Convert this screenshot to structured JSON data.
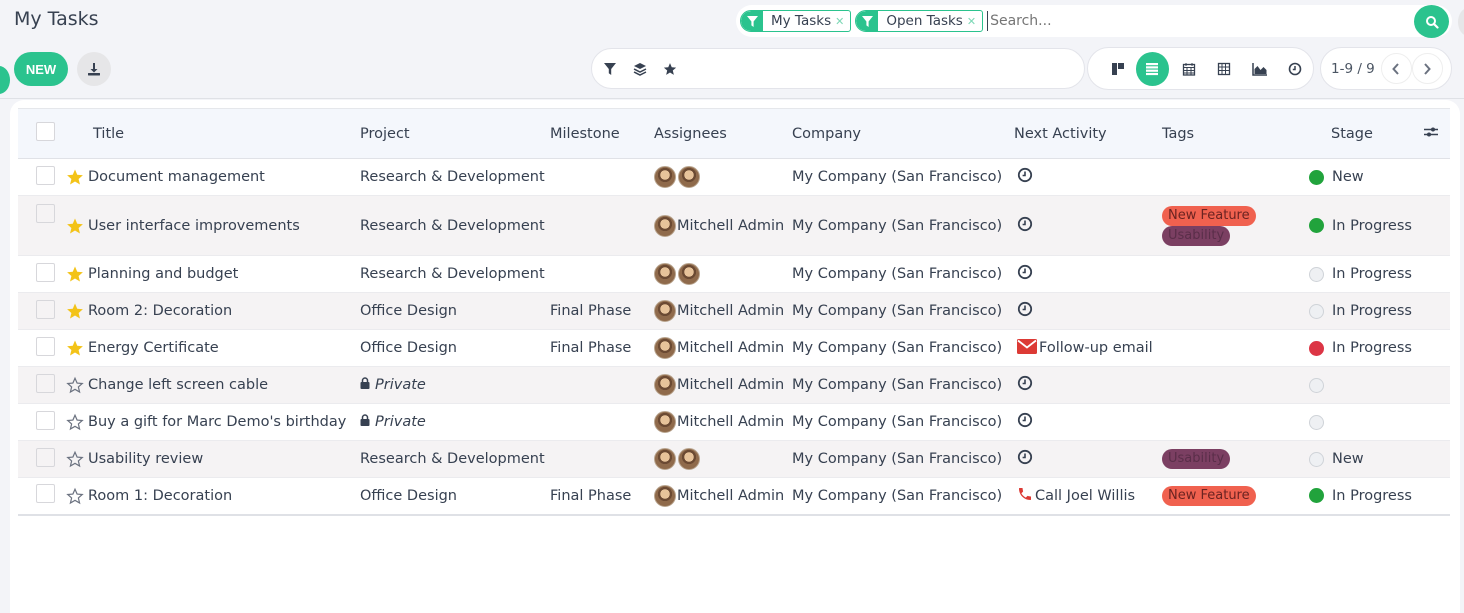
{
  "header": {
    "title": "My Tasks",
    "new_label": "NEW"
  },
  "search": {
    "facets": [
      {
        "label": "My Tasks",
        "icon": "filter-icon"
      },
      {
        "label": "Open Tasks",
        "icon": "filter-icon"
      }
    ],
    "placeholder": "Search...",
    "value": ""
  },
  "pager": {
    "value": "1-9 / 9"
  },
  "views": [
    "kanban",
    "list",
    "calendar",
    "pivot",
    "graph",
    "activity"
  ],
  "active_view": "list",
  "colors": {
    "accent": "#2bc38e",
    "tag_new_feature": "#f0614f",
    "tag_usability": "#7b3f62",
    "stage_green": "#21a33c",
    "stage_red": "#dc3545"
  },
  "table": {
    "columns": [
      "Title",
      "Project",
      "Milestone",
      "Assignees",
      "Company",
      "Next Activity",
      "Tags",
      "Stage"
    ],
    "rows": [
      {
        "starred": true,
        "title": "Document management",
        "project": "Research & Development",
        "private": false,
        "milestone": "",
        "assignees": 2,
        "assignee_name": "",
        "company": "My Company (San Francisco)",
        "activity_icon": "clock",
        "activity": "",
        "tags": [],
        "status": "green",
        "stage": "New"
      },
      {
        "starred": true,
        "title": "User interface improvements",
        "project": "Research & Development",
        "private": false,
        "milestone": "",
        "assignees": 1,
        "assignee_name": "Mitchell Admin",
        "company": "My Company (San Francisco)",
        "activity_icon": "clock",
        "activity": "",
        "tags": [
          "New Feature",
          "Usability"
        ],
        "status": "green",
        "stage": "In Progress"
      },
      {
        "starred": true,
        "title": "Planning and budget",
        "project": "Research & Development",
        "private": false,
        "milestone": "",
        "assignees": 2,
        "assignee_name": "",
        "company": "My Company (San Francisco)",
        "activity_icon": "clock",
        "activity": "",
        "tags": [],
        "status": "grey",
        "stage": "In Progress"
      },
      {
        "starred": true,
        "title": "Room 2: Decoration",
        "project": "Office Design",
        "private": false,
        "milestone": "Final Phase",
        "assignees": 1,
        "assignee_name": "Mitchell Admin",
        "company": "My Company (San Francisco)",
        "activity_icon": "clock",
        "activity": "",
        "tags": [],
        "status": "grey",
        "stage": "In Progress"
      },
      {
        "starred": true,
        "title": "Energy Certificate",
        "project": "Office Design",
        "private": false,
        "milestone": "Final Phase",
        "assignees": 1,
        "assignee_name": "Mitchell Admin",
        "company": "My Company (San Francisco)",
        "activity_icon": "envelope",
        "activity": "Follow-up email",
        "tags": [],
        "status": "red",
        "stage": "In Progress"
      },
      {
        "starred": false,
        "title": "Change left screen cable",
        "project": "Private",
        "private": true,
        "milestone": "",
        "assignees": 1,
        "assignee_name": "Mitchell Admin",
        "company": "My Company (San Francisco)",
        "activity_icon": "clock",
        "activity": "",
        "tags": [],
        "status": "grey",
        "stage": ""
      },
      {
        "starred": false,
        "title": "Buy a gift for Marc Demo's birthday",
        "project": "Private",
        "private": true,
        "milestone": "",
        "assignees": 1,
        "assignee_name": "Mitchell Admin",
        "company": "My Company (San Francisco)",
        "activity_icon": "clock",
        "activity": "",
        "tags": [],
        "status": "grey",
        "stage": ""
      },
      {
        "starred": false,
        "title": "Usability review",
        "project": "Research & Development",
        "private": false,
        "milestone": "",
        "assignees": 2,
        "assignee_name": "",
        "company": "My Company (San Francisco)",
        "activity_icon": "clock",
        "activity": "",
        "tags": [
          "Usability"
        ],
        "status": "grey",
        "stage": "New"
      },
      {
        "starred": false,
        "title": "Room 1: Decoration",
        "project": "Office Design",
        "private": false,
        "milestone": "Final Phase",
        "assignees": 1,
        "assignee_name": "Mitchell Admin",
        "company": "My Company (San Francisco)",
        "activity_icon": "phone",
        "activity": "Call Joel Willis",
        "tags": [
          "New Feature"
        ],
        "status": "green",
        "stage": "In Progress"
      }
    ]
  }
}
